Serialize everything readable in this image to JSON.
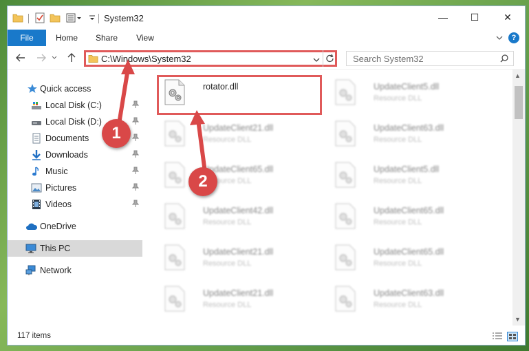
{
  "window": {
    "title": "System32",
    "quick_access_icons": [
      "folder-icon",
      "properties-icon",
      "new-folder-icon",
      "customize-dropdown-icon"
    ],
    "controls": {
      "minimize": "—",
      "maximize": "☐",
      "close": "✕"
    }
  },
  "ribbon": {
    "tabs": [
      "File",
      "Home",
      "Share",
      "View"
    ],
    "help": "?"
  },
  "address": {
    "path": "C:\\Windows\\System32",
    "search_placeholder": "Search System32"
  },
  "navigation": {
    "items": [
      {
        "label": "Quick access",
        "icon": "star-icon",
        "pinned": false
      },
      {
        "label": "Local Disk (C:)",
        "icon": "drive-icon",
        "pinned": true
      },
      {
        "label": "Local Disk (D:)",
        "icon": "drive-icon",
        "pinned": true
      },
      {
        "label": "Documents",
        "icon": "documents-icon",
        "pinned": true
      },
      {
        "label": "Downloads",
        "icon": "download-icon",
        "pinned": true
      },
      {
        "label": "Music",
        "icon": "music-icon",
        "pinned": true
      },
      {
        "label": "Pictures",
        "icon": "pictures-icon",
        "pinned": true
      },
      {
        "label": "Videos",
        "icon": "videos-icon",
        "pinned": true
      },
      {
        "label": "OneDrive",
        "icon": "cloud-icon",
        "pinned": false
      },
      {
        "label": "This PC",
        "icon": "computer-icon",
        "pinned": false,
        "selected": true
      },
      {
        "label": "Network",
        "icon": "network-icon",
        "pinned": false
      }
    ]
  },
  "files": [
    {
      "name": "rotator.dll",
      "type": ""
    },
    {
      "name": "UpdateClient5.dll",
      "type": "Resource DLL"
    },
    {
      "name": "UpdateClient21.dll",
      "type": "Resource DLL"
    },
    {
      "name": "UpdateClient63.dll",
      "type": "Resource DLL"
    },
    {
      "name": "UpdateClient65.dll",
      "type": "Resource DLL"
    },
    {
      "name": "UpdateClient5.dll",
      "type": "Resource DLL"
    },
    {
      "name": "UpdateClient42.dll",
      "type": "Resource DLL"
    },
    {
      "name": "UpdateClient65.dll",
      "type": "Resource DLL"
    },
    {
      "name": "UpdateClient21.dll",
      "type": "Resource DLL"
    },
    {
      "name": "UpdateClient65.dll",
      "type": "Resource DLL"
    },
    {
      "name": "UpdateClient21.dll",
      "type": "Resource DLL"
    },
    {
      "name": "UpdateClient63.dll",
      "type": "Resource DLL"
    }
  ],
  "status": {
    "item_count": "117 items"
  },
  "annotations": {
    "marker_1": "1",
    "marker_2": "2",
    "color": "#d94848"
  }
}
